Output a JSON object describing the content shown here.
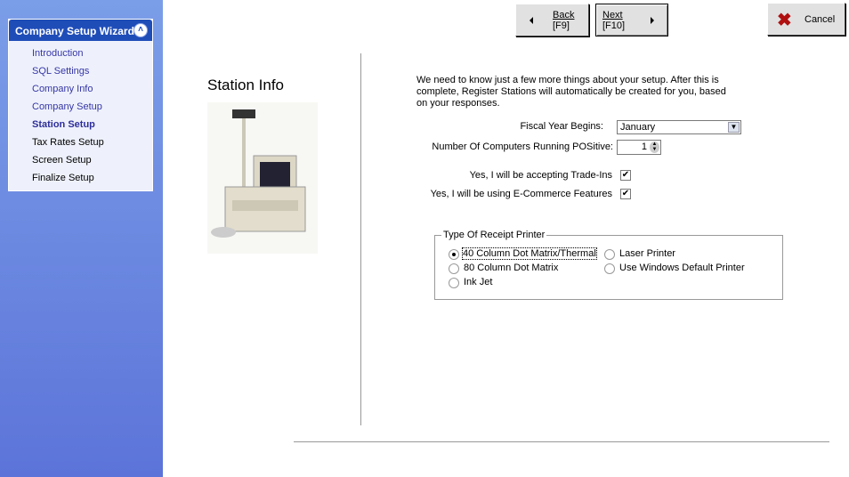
{
  "sidebar": {
    "title": "Company Setup Wizard",
    "items": [
      {
        "label": "Introduction",
        "state": "done"
      },
      {
        "label": "SQL Settings",
        "state": "done"
      },
      {
        "label": "Company Info",
        "state": "done"
      },
      {
        "label": "Company Setup",
        "state": "done"
      },
      {
        "label": "Station Setup",
        "state": "current"
      },
      {
        "label": "Tax Rates Setup",
        "state": "pending"
      },
      {
        "label": "Screen Setup",
        "state": "pending"
      },
      {
        "label": "Finalize Setup",
        "state": "pending"
      }
    ]
  },
  "toolbar": {
    "back_label": "Back",
    "back_key": "[F9]",
    "next_label": "Next",
    "next_key": "[F10]",
    "cancel_label": "Cancel"
  },
  "page": {
    "title": "Station Info",
    "intro": "We need to know just a few more things about your setup.  After this is complete, Register Stations will automatically be created for you, based on your responses.",
    "fiscal_label": "Fiscal Year Begins:",
    "fiscal_value": "January",
    "computers_label": "Number Of Computers Running POSitive:",
    "computers_value": "1",
    "tradeins_label": "Yes, I will be accepting Trade-Ins",
    "tradeins_checked": true,
    "ecommerce_label": "Yes, I will be using E-Commerce Features",
    "ecommerce_checked": true,
    "printer_group": "Type Of Receipt Printer",
    "printers": [
      {
        "label": "40 Column Dot Matrix/Thermal",
        "selected": true
      },
      {
        "label": "80 Column Dot Matrix",
        "selected": false
      },
      {
        "label": "Ink Jet",
        "selected": false
      },
      {
        "label": "Laser Printer",
        "selected": false
      },
      {
        "label": "Use Windows Default Printer",
        "selected": false
      }
    ]
  }
}
